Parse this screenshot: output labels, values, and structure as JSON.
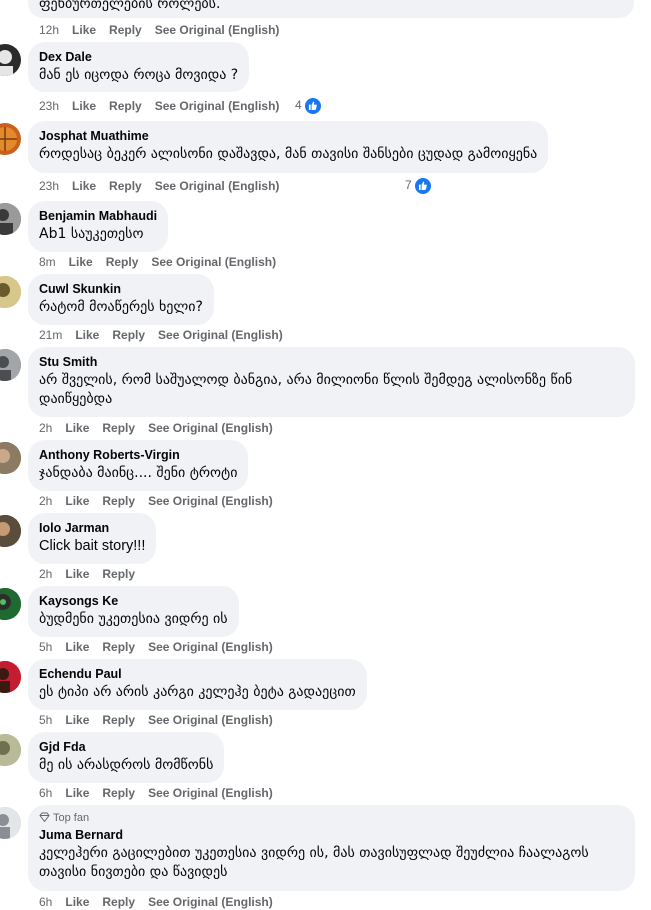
{
  "top_partial": {
    "text": "ფეხბურთელების როლებს.",
    "time": "12h",
    "like": "Like",
    "reply": "Reply",
    "see_original": "See Original (English)"
  },
  "comments": [
    {
      "author": "Dex Dale",
      "text": "მან ეს იცოდა როცა მოვიდა ?",
      "time": "23h",
      "like": "Like",
      "reply": "Reply",
      "see_original": "See Original (English)",
      "reactions": "4",
      "avatar_color": "#2b2b2b"
    },
    {
      "author": "Josphat Muathime",
      "text": "როდესაც ბეკერ ალისონი დაშავდა, მან თავისი შანსები ცუდად გამოიყენა",
      "time": "23h",
      "like": "Like",
      "reply": "Reply",
      "see_original": "See Original (English)",
      "reactions": "7",
      "avatar_color": "#c8611e"
    },
    {
      "author": "Benjamin Mabhaudi",
      "text": "Ab1 საუკეთესო",
      "time": "8m",
      "like": "Like",
      "reply": "Reply",
      "see_original": "See Original (English)",
      "avatar_color": "#6d6d6d"
    },
    {
      "author": "Cuwl Skunkin",
      "text": "რატომ მოაწერეს ხელი?",
      "time": "21m",
      "like": "Like",
      "reply": "Reply",
      "see_original": "See Original (English)",
      "avatar_color": "#b8a15c"
    },
    {
      "author": "Stu Smith",
      "text": "არ შველის, რომ საშუალოდ ბანგია, არა მილიონი წლის შემდეგ ალისონზე წინ დაიწყებდა",
      "time": "2h",
      "like": "Like",
      "reply": "Reply",
      "see_original": "See Original (English)",
      "avatar_color": "#7a7d80"
    },
    {
      "author": "Anthony Roberts-Virgin",
      "text": "ჯანდაბა მაინც.... შენი ტროტი",
      "time": "2h",
      "like": "Like",
      "reply": "Reply",
      "see_original": "See Original (English)",
      "avatar_color": "#6b5a46"
    },
    {
      "author": "Iolo Jarman",
      "text": "Click bait story!!!",
      "time": "2h",
      "like": "Like",
      "reply": "Reply",
      "avatar_color": "#4a4034"
    },
    {
      "author": "Kaysongs Ke",
      "text": "ბუდმენი უკეთესია ვიდრე ის",
      "time": "5h",
      "like": "Like",
      "reply": "Reply",
      "see_original": "See Original (English)",
      "avatar_color": "#1e5b2c"
    },
    {
      "author": "Echendu Paul",
      "text": "ეს ტიპი არ არის კარგი კელეჰე ბეტა გადაეცით",
      "time": "5h",
      "like": "Like",
      "reply": "Reply",
      "see_original": "See Original (English)",
      "avatar_color": "#c41d32"
    },
    {
      "author": "Gjd Fda",
      "text": "მე ის არასდროს მომწონს",
      "time": "6h",
      "like": "Like",
      "reply": "Reply",
      "see_original": "See Original (English)",
      "avatar_color": "#9ea07a"
    },
    {
      "author": "Juma Bernard",
      "badge": "Top fan",
      "text": "კელეჰერი გაცილებით უკეთესია ვიდრე ის, მას თავისუფლად შეუძლია ჩაალაგოს თავისი ნივთები და წავიდეს",
      "time": "6h",
      "like": "Like",
      "reply": "Reply",
      "see_original": "See Original (English)",
      "avatar_color": "#c9ccd1"
    }
  ]
}
